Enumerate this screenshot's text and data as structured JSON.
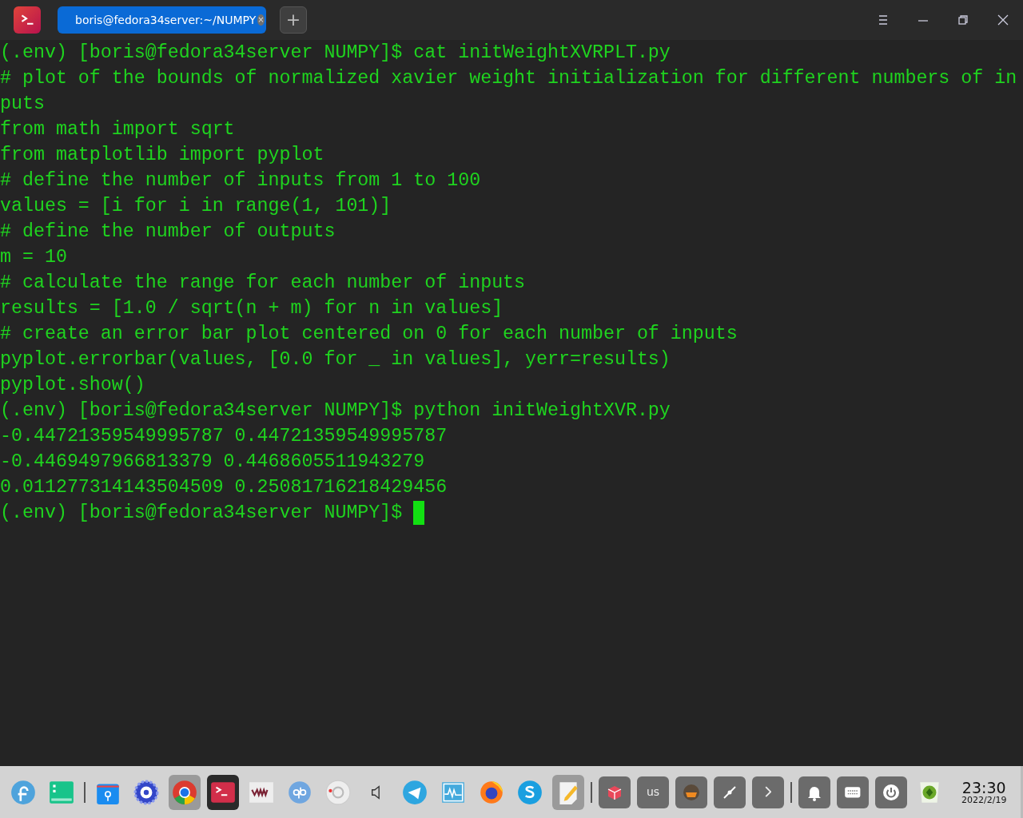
{
  "titlebar": {
    "tabs": [
      {
        "label": "boris@fedora34server:~/NUMPY",
        "selected": true,
        "close": "×"
      }
    ],
    "new_tab": "+"
  },
  "terminal": {
    "lines": [
      "(.env) [boris@fedora34server NUMPY]$ cat initWeightXVRPLT.py",
      "# plot of the bounds of normalized xavier weight initialization for different numbers of in",
      "puts",
      "from math import sqrt",
      "from matplotlib import pyplot",
      "# define the number of inputs from 1 to 100",
      "values = [i for i in range(1, 101)]",
      "# define the number of outputs",
      "m = 10",
      "# calculate the range for each number of inputs",
      "results = [1.0 / sqrt(n + m) for n in values]",
      "# create an error bar plot centered on 0 for each number of inputs",
      "pyplot.errorbar(values, [0.0 for _ in values], yerr=results)",
      "pyplot.show()",
      "(.env) [boris@fedora34server NUMPY]$ python initWeightXVR.py",
      "-0.44721359549995787 0.44721359549995787",
      "-0.4469497966813379 0.4468605511943279",
      "0.011277314143504509 0.25081716218429456",
      "(.env) [boris@fedora34server NUMPY]$ "
    ],
    "cursor": true
  },
  "taskbar": {
    "items": [
      {
        "kind": "fedora",
        "running": false,
        "selected": false
      },
      {
        "kind": "files",
        "running": false,
        "selected": false
      },
      {
        "kind": "separator"
      },
      {
        "kind": "store",
        "running": false,
        "selected": false
      },
      {
        "kind": "gear",
        "running": false,
        "selected": false
      },
      {
        "kind": "chrome",
        "running": true,
        "selected": false
      },
      {
        "kind": "terminal",
        "selected": true
      },
      {
        "kind": "vm",
        "running": false,
        "selected": false
      },
      {
        "kind": "qb",
        "running": false,
        "selected": false
      },
      {
        "kind": "disc",
        "running": false,
        "selected": false
      },
      {
        "kind": "speaker",
        "running": false,
        "selected": false
      },
      {
        "kind": "telegram",
        "running": false,
        "selected": false
      },
      {
        "kind": "monitor",
        "running": false,
        "selected": false
      },
      {
        "kind": "firefox",
        "running": false,
        "selected": false
      },
      {
        "kind": "skype",
        "running": false,
        "selected": false
      },
      {
        "kind": "note",
        "running": true,
        "selected": false
      },
      {
        "kind": "separator"
      },
      {
        "kind": "tray-cube"
      },
      {
        "kind": "tray-text",
        "label": "us"
      },
      {
        "kind": "tray-basket"
      },
      {
        "kind": "tray-plug"
      },
      {
        "kind": "tray-arrow"
      },
      {
        "kind": "separator"
      },
      {
        "kind": "tray-bell"
      },
      {
        "kind": "tray-keyboard"
      },
      {
        "kind": "tray-power"
      },
      {
        "kind": "trash"
      }
    ],
    "clock": {
      "time": "23:30",
      "date": "2022/2/19"
    }
  }
}
